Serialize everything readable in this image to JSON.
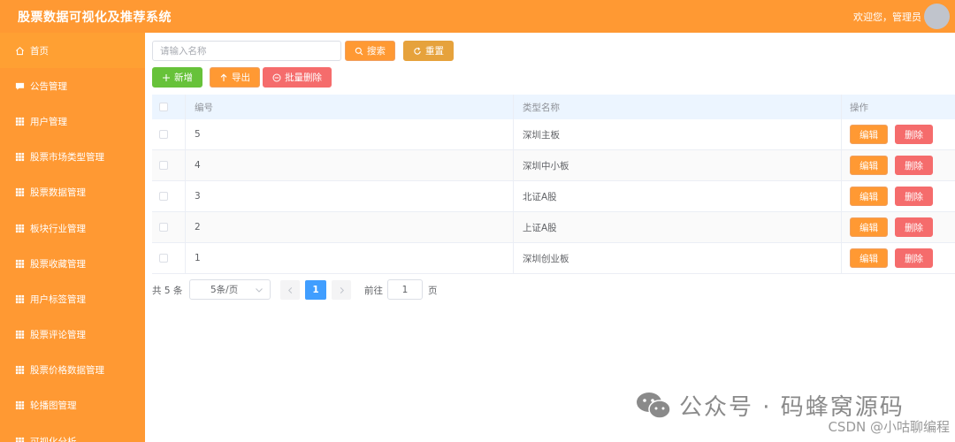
{
  "header": {
    "title": "股票数据可视化及推荐系统",
    "welcome": "欢迎您，管理员"
  },
  "sidebar": {
    "items": [
      {
        "label": "首页",
        "icon": "home-icon"
      },
      {
        "label": "公告管理",
        "icon": "chat-icon"
      },
      {
        "label": "用户管理",
        "icon": "grid-icon"
      },
      {
        "label": "股票市场类型管理",
        "icon": "grid-icon"
      },
      {
        "label": "股票数据管理",
        "icon": "grid-icon"
      },
      {
        "label": "板块行业管理",
        "icon": "grid-icon"
      },
      {
        "label": "股票收藏管理",
        "icon": "grid-icon"
      },
      {
        "label": "用户标签管理",
        "icon": "grid-icon"
      },
      {
        "label": "股票评论管理",
        "icon": "grid-icon"
      },
      {
        "label": "股票价格数据管理",
        "icon": "grid-icon"
      },
      {
        "label": "轮播图管理",
        "icon": "grid-icon"
      },
      {
        "label": "可视化分析",
        "icon": "grid-icon"
      }
    ]
  },
  "toolbar": {
    "search_placeholder": "请输入名称",
    "search_label": "搜索",
    "reset_label": "重置",
    "add_label": "新增",
    "export_label": "导出",
    "batch_delete_label": "批量删除"
  },
  "table": {
    "columns": [
      "编号",
      "类型名称",
      "操作"
    ],
    "rows": [
      {
        "id": "5",
        "name": "深圳主板"
      },
      {
        "id": "4",
        "name": "深圳中小板"
      },
      {
        "id": "3",
        "name": "北证A股"
      },
      {
        "id": "2",
        "name": "上证A股"
      },
      {
        "id": "1",
        "name": "深圳创业板"
      }
    ],
    "edit_label": "编辑",
    "delete_label": "删除"
  },
  "pagination": {
    "total": "共 5 条",
    "page_size": "5条/页",
    "current_page": "1",
    "goto_label": "前往",
    "goto_value": "1",
    "goto_suffix": "页"
  },
  "watermark": {
    "text": "公众号 · 码蜂窝源码",
    "csdn": "CSDN @小咕聊编程"
  },
  "colors": {
    "brand": "#ff9933",
    "danger": "#f56c6c",
    "success": "#67c23a",
    "primary": "#409eff"
  }
}
